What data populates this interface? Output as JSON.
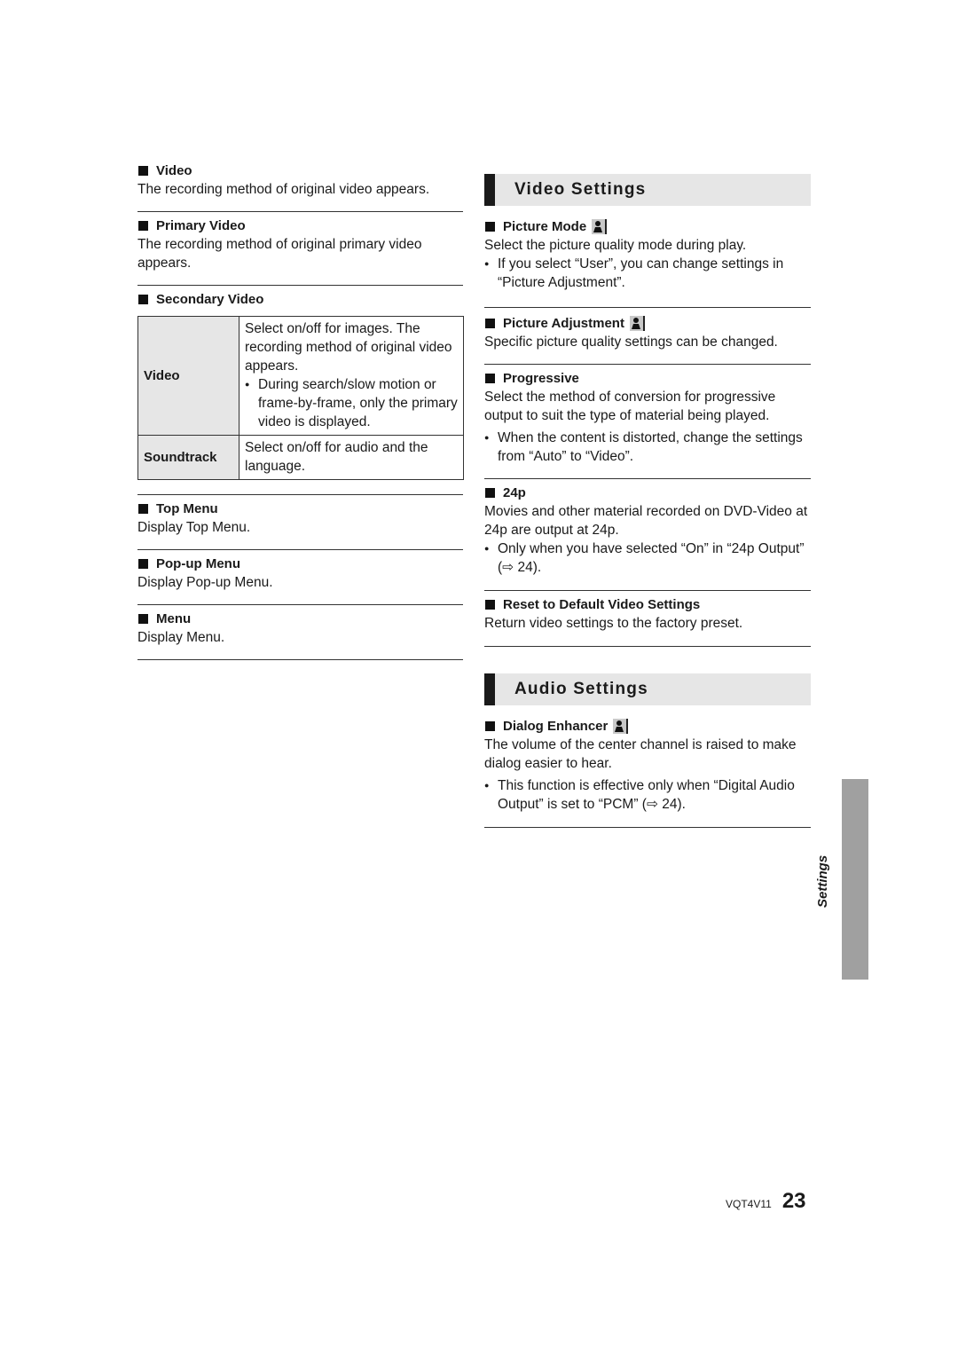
{
  "left_column": {
    "video": {
      "title": "Video",
      "text": "The recording method of original video appears."
    },
    "primary_video": {
      "title": "Primary Video",
      "text": "The recording method of original primary video appears."
    },
    "secondary_video": {
      "title": "Secondary Video",
      "table": [
        {
          "label": "Video",
          "lines": [
            "Select on/off for images. The recording method of original video appears."
          ],
          "bullet": "During search/slow motion or frame-by-frame, only the primary video is displayed."
        },
        {
          "label": "Soundtrack",
          "lines": [
            "Select on/off for audio and the language."
          ]
        }
      ]
    },
    "top_menu": {
      "title": "Top Menu",
      "text": "Display Top Menu."
    },
    "popup_menu": {
      "title": "Pop-up Menu",
      "text": "Display Pop-up Menu."
    },
    "menu": {
      "title": "Menu",
      "text": "Display Menu."
    }
  },
  "video_settings": {
    "heading": "Video Settings",
    "picture_mode": {
      "title": "Picture Mode",
      "icon": "person-icon",
      "text": "Select the picture quality mode during play.",
      "bullet": "If you select “User”, you can change settings in “Picture Adjustment”."
    },
    "picture_adjustment": {
      "title": "Picture Adjustment",
      "icon": "person-icon",
      "text": "Specific picture quality settings can be changed."
    },
    "progressive": {
      "title": "Progressive",
      "text": "Select the method of conversion for progressive output to suit the type of material being played.",
      "bullet": "When the content is distorted, change the settings from “Auto” to “Video”."
    },
    "p24": {
      "title": "24p",
      "text": "Movies and other material recorded on DVD-Video at 24p are output at 24p.",
      "bullet": "Only when you have selected “On” in “24p Output” (⇨ 24)."
    },
    "reset": {
      "title": "Reset to Default Video Settings",
      "text": "Return video settings to the factory preset."
    }
  },
  "audio_settings": {
    "heading": "Audio Settings",
    "dialog_enhancer": {
      "title": "Dialog Enhancer",
      "icon": "person-icon",
      "text": "The volume of the center channel is raised to make dialog easier to hear.",
      "bullet": "This function is effective only when “Digital Audio Output” is set to “PCM” (⇨ 24)."
    }
  },
  "side_tab": {
    "label": "Settings"
  },
  "footer": {
    "code": "VQT4V11",
    "page": "23"
  }
}
